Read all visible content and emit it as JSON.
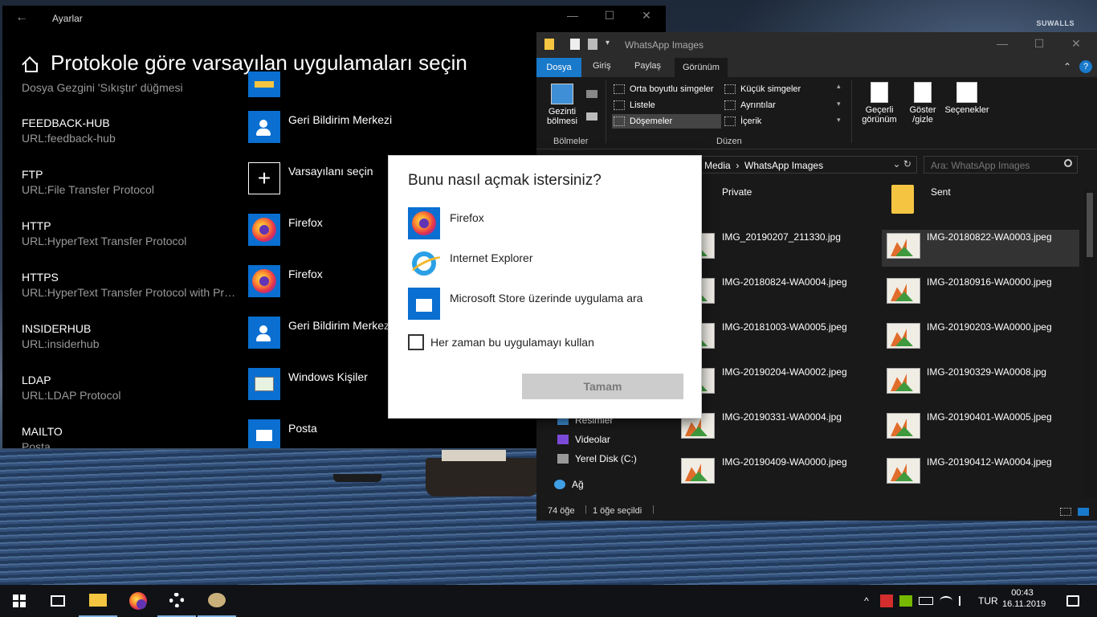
{
  "watermark": "SUWALLS",
  "settings": {
    "window_title": "Ayarlar",
    "heading": "Protokole göre varsayılan uygulamaları seçin",
    "cut_top_desc": "Dosya Gezgini 'Sıkıştır' düğmesi",
    "rows": [
      {
        "name": "FEEDBACK-HUB",
        "desc": "URL:feedback-hub",
        "app": "Geri Bildirim Merkezi",
        "icon": "feedback-hub-icon"
      },
      {
        "name": "FTP",
        "desc": "URL:File Transfer Protocol",
        "app": "Varsayılanı seçin",
        "icon": "plus-icon"
      },
      {
        "name": "HTTP",
        "desc": "URL:HyperText Transfer Protocol",
        "app": "Firefox",
        "icon": "firefox-icon"
      },
      {
        "name": "HTTPS",
        "desc": "URL:HyperText Transfer Protocol with Priv...",
        "app": "Firefox",
        "icon": "firefox-icon"
      },
      {
        "name": "INSIDERHUB",
        "desc": "URL:insiderhub",
        "app": "Geri Bildirim Merkezi",
        "icon": "feedback-hub-icon"
      },
      {
        "name": "LDAP",
        "desc": "URL:LDAP Protocol",
        "app": "Windows Kişiler",
        "icon": "people-icon"
      },
      {
        "name": "MAILTO",
        "desc": "Posta",
        "app": "Posta",
        "icon": "mail-icon"
      }
    ]
  },
  "explorer": {
    "title": "WhatsApp Images",
    "tabs": {
      "file": "Dosya",
      "home": "Giriş",
      "share": "Paylaş",
      "view": "Görünüm"
    },
    "ribbon": {
      "nav_pane": "Gezinti bölmesi",
      "panes_group": "Bölmeler",
      "layout_group": "Düzen",
      "layouts": [
        "Orta boyutlu simgeler",
        "Küçük simgeler",
        "Listele",
        "Ayrıntılar",
        "Döşemeler",
        "İçerik"
      ],
      "current_view": "Geçerli görünüm",
      "show_hide": "Göster /gizle",
      "options": "Seçenekler"
    },
    "address": {
      "part1": "Media",
      "part2": "WhatsApp Images"
    },
    "search_placeholder": "Ara: WhatsApp Images",
    "nav_items": [
      "Resimler",
      "Videolar",
      "Yerel Disk (C:)",
      "Ağ"
    ],
    "folders": [
      "Private",
      "Sent"
    ],
    "files": [
      "IMG_20190207_211330.jpg",
      "IMG-20180822-WA0003.jpeg",
      "IMG-20180824-WA0004.jpeg",
      "IMG-20180916-WA0000.jpeg",
      "IMG-20181003-WA0005.jpeg",
      "IMG-20190203-WA0000.jpeg",
      "IMG-20190204-WA0002.jpeg",
      "IMG-20190329-WA0008.jpg",
      "IMG-20190331-WA0004.jpg",
      "IMG-20190401-WA0005.jpeg",
      "IMG-20190409-WA0000.jpeg",
      "IMG-20190412-WA0004.jpeg"
    ],
    "selected_file": "IMG-20180822-WA0003.jpeg",
    "status_count": "74 öğe",
    "status_selected": "1 öğe seçildi"
  },
  "dialog": {
    "question": "Bunu nasıl açmak istersiniz?",
    "options": [
      {
        "label": "Firefox",
        "icon": "firefox-icon"
      },
      {
        "label": "Internet Explorer",
        "icon": "internet-explorer-icon"
      },
      {
        "label": "Microsoft Store üzerinde uygulama ara",
        "icon": "store-icon"
      }
    ],
    "always_use": "Her zaman bu uygulamayı kullan",
    "ok": "Tamam"
  },
  "taskbar": {
    "lang": "TUR",
    "time": "00:43",
    "date": "16.11.2019"
  }
}
